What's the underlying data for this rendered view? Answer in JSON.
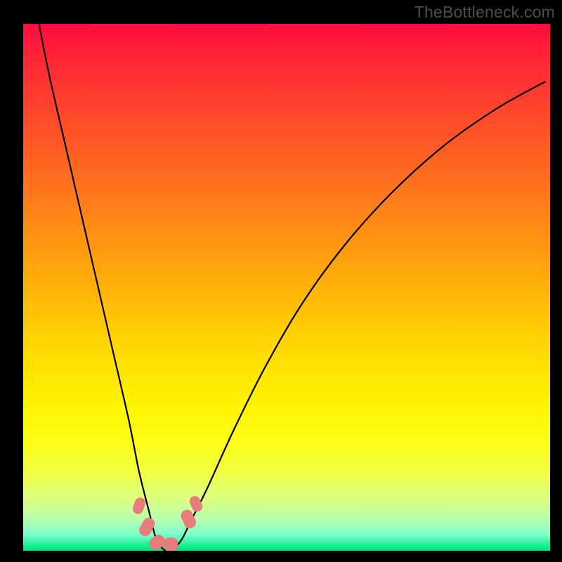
{
  "attribution": "TheBottleneck.com",
  "chart_data": {
    "type": "line",
    "title": "",
    "xlabel": "",
    "ylabel": "",
    "xlim": [
      0,
      100
    ],
    "ylim": [
      0,
      100
    ],
    "grid": false,
    "legend": false,
    "series": [
      {
        "name": "bottleneck-curve",
        "x": [
          3,
          5,
          8,
          11,
          14,
          17,
          20,
          22,
          24,
          25,
          26,
          27,
          28,
          30,
          32,
          35,
          40,
          46,
          53,
          61,
          70,
          80,
          90,
          99
        ],
        "y": [
          100,
          90,
          77,
          64,
          51,
          38,
          25,
          15,
          7,
          3,
          1,
          0,
          0,
          2,
          6,
          12,
          23,
          35,
          47,
          58,
          68,
          77,
          84,
          89
        ]
      }
    ],
    "markers": [
      {
        "x": 22.0,
        "y": 8.5,
        "w": 2.0,
        "h": 3.2,
        "rot": 20
      },
      {
        "x": 23.5,
        "y": 4.5,
        "w": 2.2,
        "h": 3.6,
        "rot": 30
      },
      {
        "x": 25.5,
        "y": 1.6,
        "w": 2.4,
        "h": 3.0,
        "rot": 55
      },
      {
        "x": 28.0,
        "y": 1.2,
        "w": 2.6,
        "h": 2.6,
        "rot": 0
      },
      {
        "x": 31.3,
        "y": 6.0,
        "w": 2.2,
        "h": 3.6,
        "rot": -25
      },
      {
        "x": 32.8,
        "y": 9.0,
        "w": 2.0,
        "h": 3.0,
        "rot": -25
      }
    ],
    "annotations": []
  }
}
